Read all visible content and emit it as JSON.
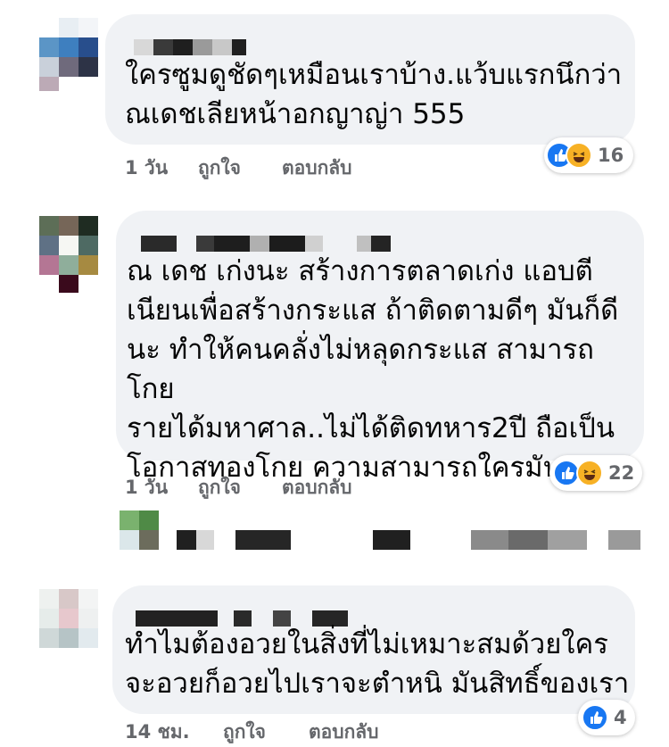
{
  "comments": [
    {
      "text": "ใครซูมดูชัดๆเหมือนเราบ้าง.แว้บแรกนึกว่า\nณเดชเลียหน้าอกญาญ่า 555",
      "time": "1 วัน",
      "like": "ถูกใจ",
      "reply": "ตอบกลับ",
      "reactions": [
        "like-icon",
        "haha-icon"
      ],
      "reaction_count": "16"
    },
    {
      "text": "ณ เดช เก่งนะ สร้างการตลาดเก่ง แอบตี\nเนียนเพื่อสร้างกระแส ถ้าติดตามดีๆ มันก็ดี\nนะ ทำให้คนคลั่งไม่หลุดกระแส สามารถโกย\nรายได้มหาศาล..ไม่ได้ติดทหาร2ปี ถือเป็น\nโอกาสทองโกย ความสามารถใครมัน",
      "time": "1 วัน",
      "like": "ถูกใจ",
      "reply": "ตอบกลับ",
      "reactions": [
        "like-icon",
        "haha-icon"
      ],
      "reaction_count": "22"
    },
    {
      "text": "ทำไมต้องอวยในสิ่งที่ไม่เหมาะสมด้วยใคร\nจะอวยก็อวยไปเราจะตำหนิ มันสิทธิ์ของเรา",
      "time": "14 ชม.",
      "like": "ถูกใจ",
      "reply": "ตอบกลับ",
      "reactions": [
        "like-icon"
      ],
      "reaction_count": "4"
    }
  ],
  "colors": {
    "bubble": "#f0f2f5",
    "meta_text": "#65676b",
    "like_blue": "#1877f2",
    "haha_yellow": "#f7b125"
  }
}
